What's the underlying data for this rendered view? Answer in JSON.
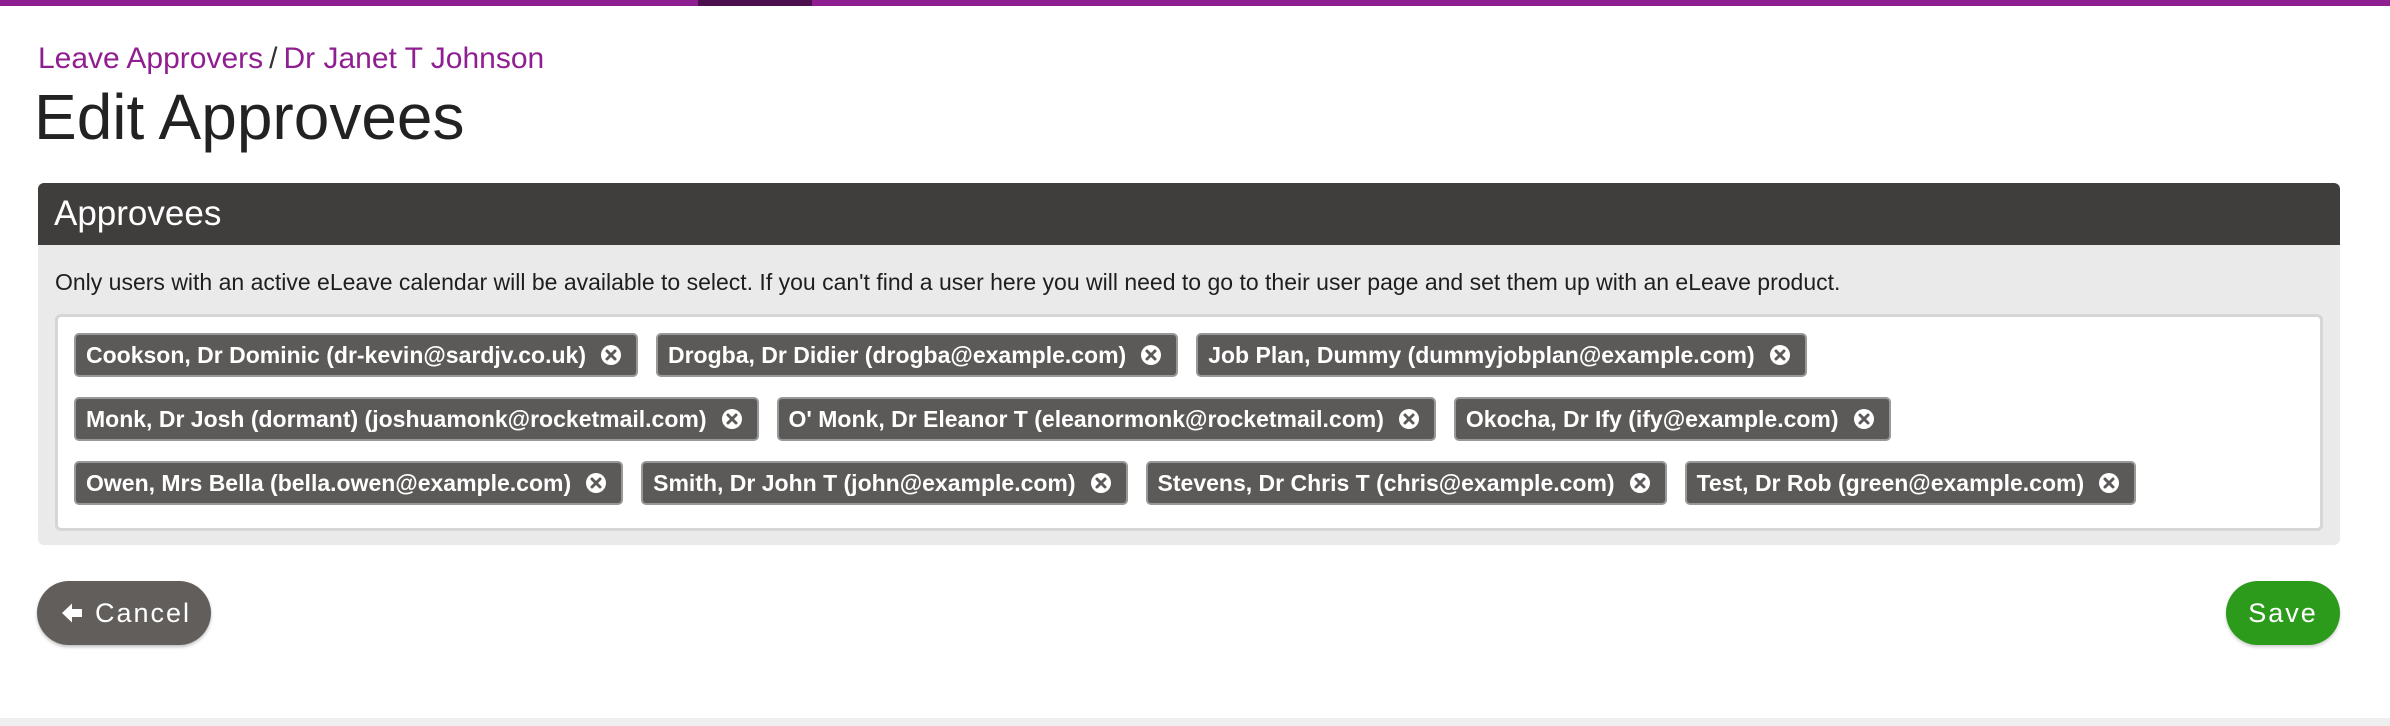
{
  "colors": {
    "brand": "#8f1f91",
    "panel_header": "#403e3d",
    "chip": "#5c5a58",
    "cancel": "#625e5b",
    "save": "#2c9b1c"
  },
  "breadcrumb": {
    "parent": "Leave Approvers",
    "separator": "/",
    "current": "Dr Janet T Johnson"
  },
  "page_title": "Edit Approvees",
  "panel": {
    "title": "Approvees",
    "note": "Only users with an active eLeave calendar will be available to select. If you can't find a user here you will need to go to their user page and set them up with an eLeave product.",
    "chip_remove_icon": "times-circle-icon",
    "approvees": [
      "Cookson, Dr Dominic (dr-kevin@sardjv.co.uk)",
      "Drogba, Dr Didier (drogba@example.com)",
      "Job Plan, Dummy (dummyjobplan@example.com)",
      "Monk, Dr Josh (dormant) (joshuamonk@rocketmail.com)",
      "O' Monk, Dr Eleanor T (eleanormonk@rocketmail.com)",
      "Okocha, Dr Ify (ify@example.com)",
      "Owen, Mrs Bella (bella.owen@example.com)",
      "Smith, Dr John T (john@example.com)",
      "Stevens, Dr Chris T (chris@example.com)",
      "Test, Dr Rob (green@example.com)"
    ]
  },
  "actions": {
    "cancel_label": "Cancel",
    "cancel_icon": "arrow-left-icon",
    "save_label": "Save"
  }
}
